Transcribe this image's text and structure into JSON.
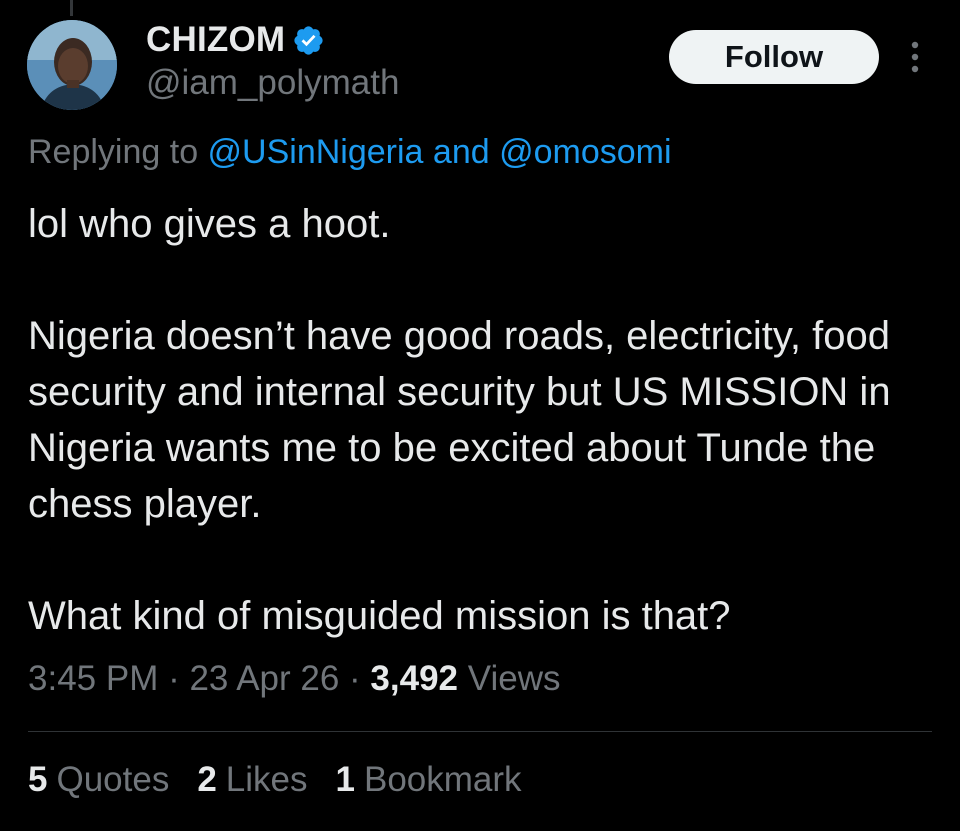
{
  "author": {
    "display_name": "CHIZOM",
    "handle": "@iam_polymath",
    "verified": true
  },
  "actions": {
    "follow_label": "Follow"
  },
  "reply": {
    "prefix": "Replying to ",
    "mention_1": "@USinNigeria",
    "connector": " and ",
    "mention_2": "@omosomi"
  },
  "tweet": {
    "paragraphs": [
      "lol who gives a hoot.",
      "Nigeria doesn’t have good roads, electricity, food security and internal security but US MISSION in Nigeria wants me to be excited about Tunde the chess player.",
      "What kind of misguided mission is that?"
    ]
  },
  "meta": {
    "time": "3:45 PM",
    "separator": " · ",
    "date": "23 Apr 26",
    "views_count": "3,492",
    "views_label": " Views"
  },
  "stats": {
    "quotes_count": "5",
    "quotes_label": "Quotes",
    "likes_count": "2",
    "likes_label": "Likes",
    "bookmarks_count": "1",
    "bookmarks_label": "Bookmark"
  },
  "colors": {
    "background": "#000000",
    "text_primary": "#e7e9ea",
    "text_secondary": "#71767b",
    "accent": "#1d9bf0",
    "follow_bg": "#eff3f4"
  }
}
